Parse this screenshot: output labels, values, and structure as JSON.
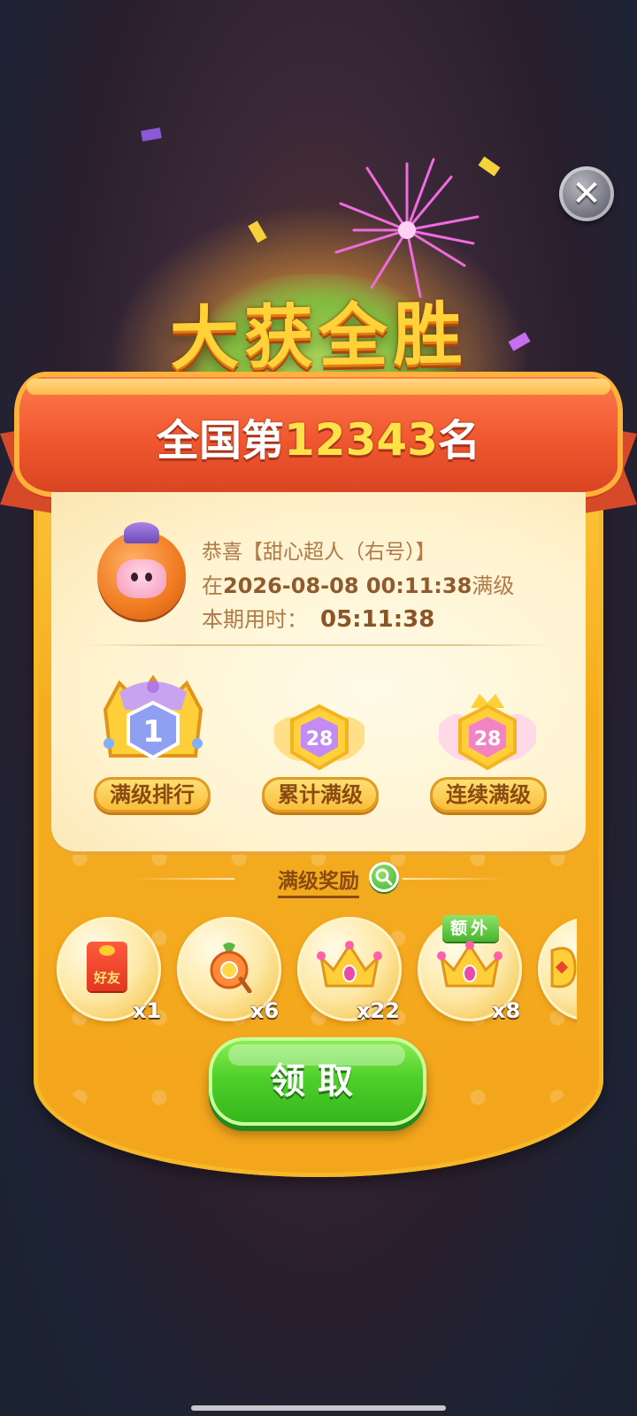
{
  "header": {
    "victory_title": "大获全胜",
    "rank_prefix": "全国第",
    "rank_number": "12343",
    "rank_suffix": "名"
  },
  "player": {
    "congrats_prefix": "恭喜",
    "nickname_line": "【甜心超人（右号）】",
    "level_time_prefix": "在",
    "level_time": "2026-08-08 00:11:38",
    "level_time_suffix": "满级",
    "period_label": "本期用时：",
    "period_time": "05:11:38"
  },
  "badges": [
    {
      "value": "1",
      "label": "满级排行"
    },
    {
      "value": "28",
      "label": "累计满级"
    },
    {
      "value": "28",
      "label": "连续满级"
    }
  ],
  "rewards": {
    "title": "满级奖励",
    "extra_tag": "额外",
    "items": [
      {
        "icon": "red-packet-icon",
        "icon_text": "好友",
        "qty": "x1"
      },
      {
        "icon": "magic-orb-icon",
        "qty": "x6"
      },
      {
        "icon": "crown-icon",
        "qty": "x22"
      },
      {
        "icon": "crown-icon",
        "qty": "x8"
      },
      {
        "icon": "partial-item-icon",
        "qty": ""
      }
    ]
  },
  "claim_label": "领取",
  "colors": {
    "ribbon": "#f0572f",
    "card": "#f5ad1f",
    "claim_button": "#4fd02a",
    "rank_highlight": "#ffe14a"
  }
}
